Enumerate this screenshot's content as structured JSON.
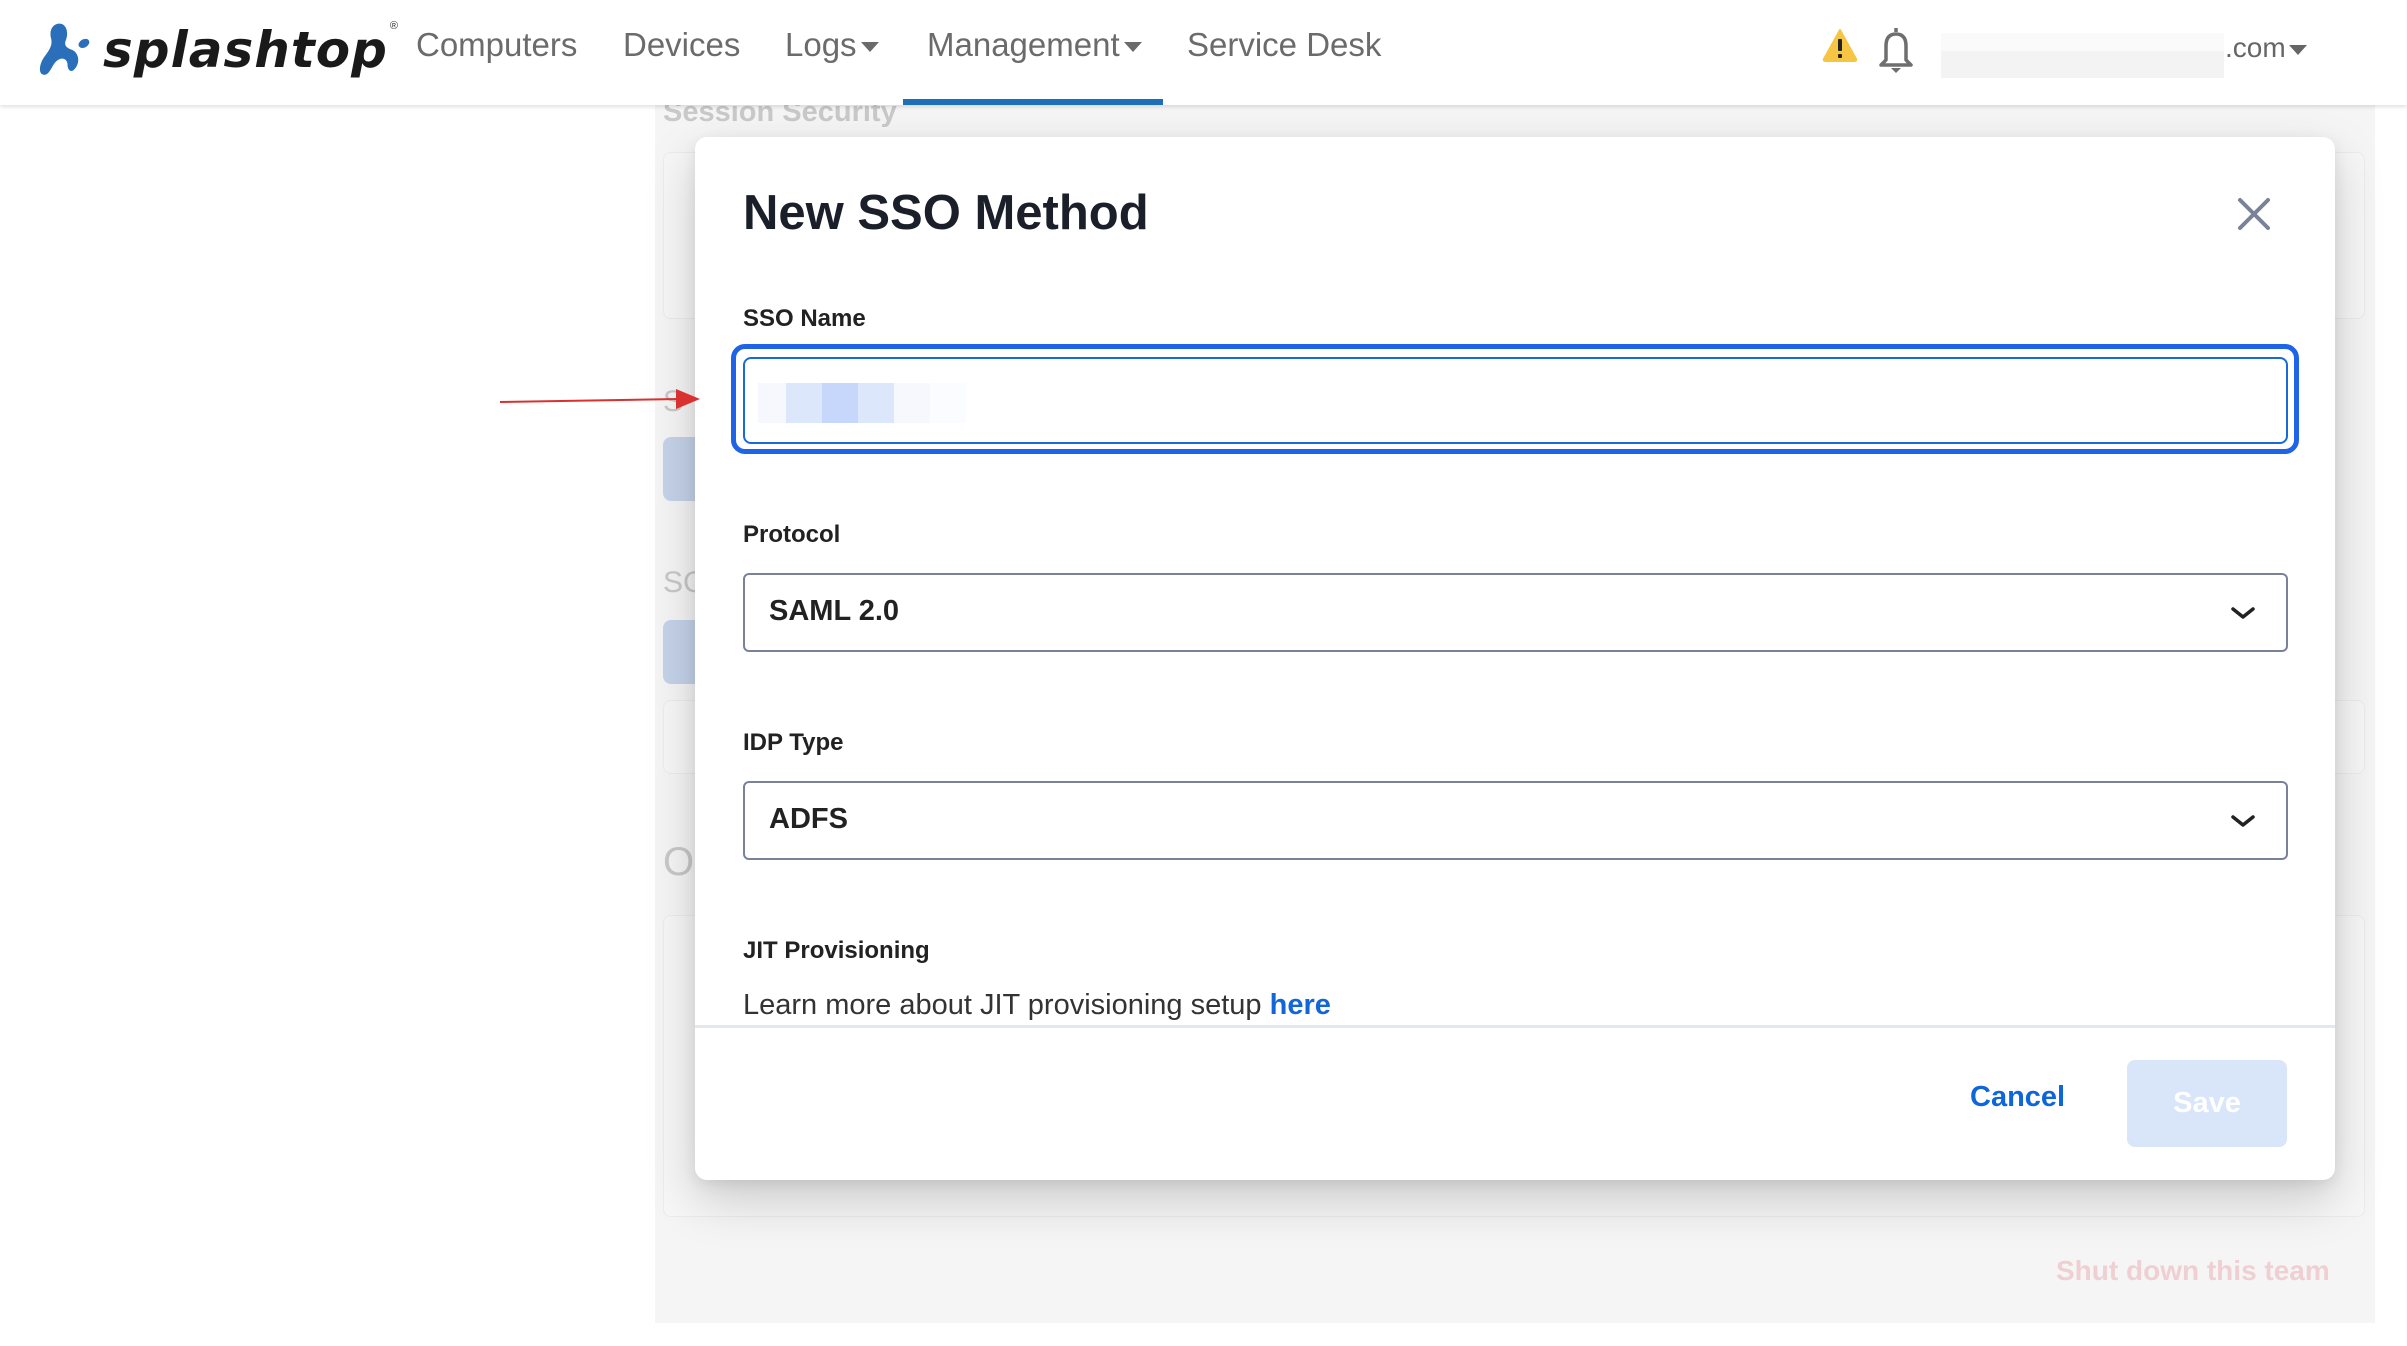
{
  "navbar": {
    "logo_text": "splashtop",
    "logo_reg": "®",
    "items": [
      {
        "label": "Computers",
        "has_dropdown": false
      },
      {
        "label": "Devices",
        "has_dropdown": false
      },
      {
        "label": "Logs",
        "has_dropdown": true
      },
      {
        "label": "Management",
        "has_dropdown": true,
        "active": true
      },
      {
        "label": "Service Desk",
        "has_dropdown": false
      }
    ],
    "account_suffix": ".com",
    "icons": [
      "warning-icon",
      "bell-icon"
    ],
    "active_color": "#1d6fb8"
  },
  "background_page": {
    "heading": "Session Security",
    "section_initials": [
      "S",
      "SC",
      "O"
    ],
    "danger_link": "Shut down this team"
  },
  "modal": {
    "title": "New SSO Method",
    "fields": {
      "sso_name": {
        "label": "SSO Name",
        "value": "",
        "redacted": true,
        "focused": true
      },
      "protocol": {
        "label": "Protocol",
        "value": "SAML 2.0"
      },
      "idp_type": {
        "label": "IDP Type",
        "value": "ADFS"
      },
      "jit": {
        "label": "JIT Provisioning",
        "text": "Learn more about JIT provisioning setup",
        "link_text": "here"
      }
    },
    "buttons": {
      "cancel": "Cancel",
      "save": "Save",
      "save_disabled": true
    },
    "colors": {
      "focus_ring": "#1f63e6",
      "link": "#1366d6",
      "save_disabled_bg": "#d9e5f8"
    }
  },
  "annotation": {
    "type": "arrow",
    "color": "#d93030",
    "points_to": "sso-name-input"
  }
}
